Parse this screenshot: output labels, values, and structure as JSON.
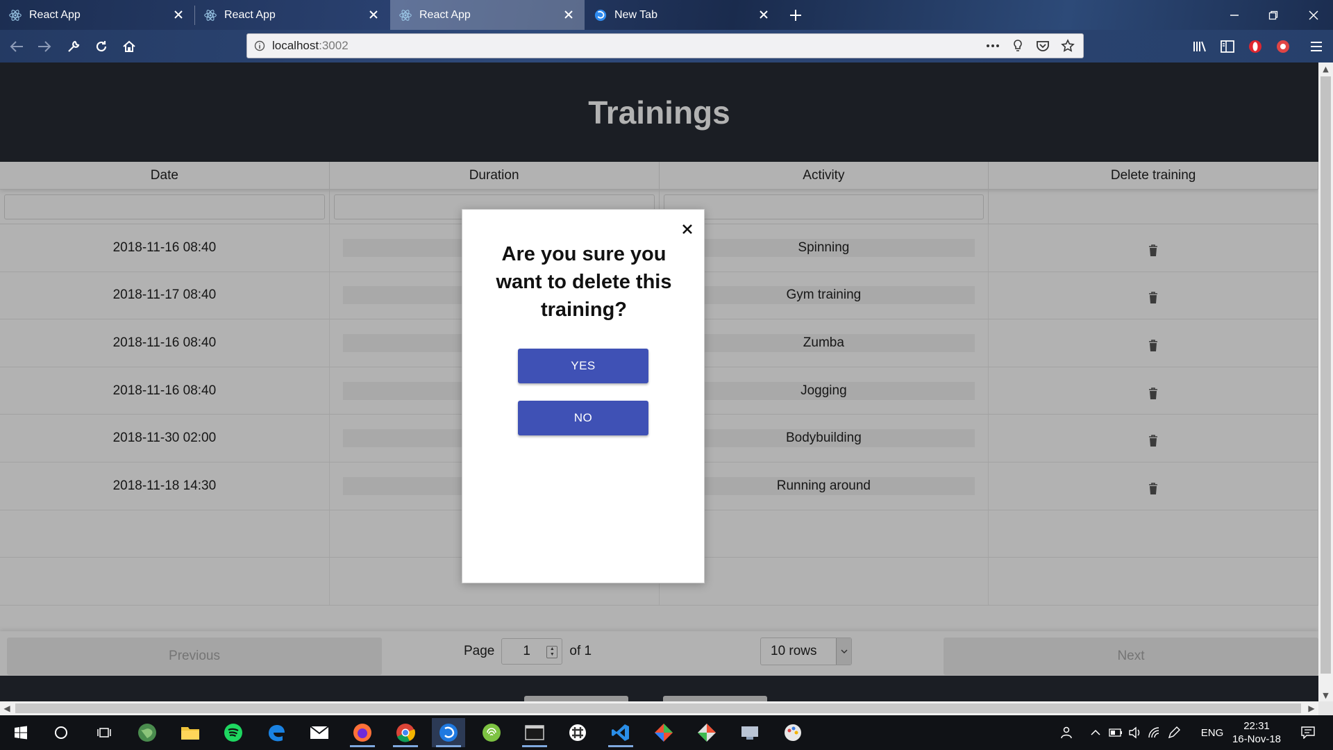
{
  "browser": {
    "tabs": [
      {
        "title": "React App"
      },
      {
        "title": "React App"
      },
      {
        "title": "React App"
      },
      {
        "title": "New Tab"
      }
    ],
    "url_host": "localhost",
    "url_port": ":3002"
  },
  "page": {
    "title": "Trainings",
    "columns": [
      "Date",
      "Duration",
      "Activity",
      "Delete training"
    ],
    "rows": [
      {
        "date": "2018-11-16 08:40",
        "activity": "Spinning"
      },
      {
        "date": "2018-11-17 08:40",
        "activity": "Gym training"
      },
      {
        "date": "2018-11-16 08:40",
        "activity": "Zumba"
      },
      {
        "date": "2018-11-16 08:40",
        "activity": "Jogging"
      },
      {
        "date": "2018-11-30 02:00",
        "activity": "Bodybuilding"
      },
      {
        "date": "2018-11-18 14:30",
        "activity": "Running around"
      }
    ],
    "pagination": {
      "previous": "Previous",
      "next": "Next",
      "page_label": "Page",
      "page_value": "1",
      "of_label": "of 1",
      "rows_option": "10 rows"
    }
  },
  "dialog": {
    "title": "Are you sure you want to delete this training?",
    "yes": "YES",
    "no": "NO"
  },
  "taskbar": {
    "language": "ENG",
    "time": "22:31",
    "date": "16-Nov-18"
  },
  "colors": {
    "header_bg": "#282c34",
    "button_primary": "#3f51b5"
  }
}
